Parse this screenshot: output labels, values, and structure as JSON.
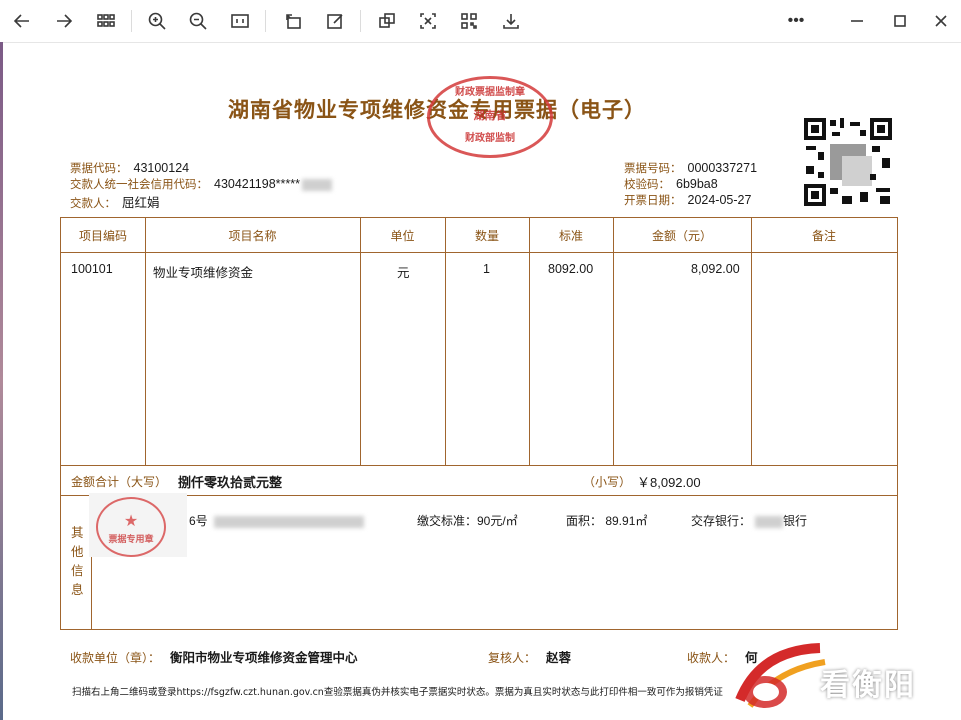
{
  "toolbar": {
    "back": "back",
    "forward": "forward",
    "thumbs": "thumbnails",
    "zoom_in": "zoom-in",
    "zoom_out": "zoom-out",
    "actual": "1:1",
    "rotate": "rotate",
    "edit": "edit",
    "translate": "translate",
    "text": "文",
    "qr": "qr",
    "save": "save",
    "more": "•••"
  },
  "doc": {
    "title": "湖南省物业专项维修资金专用票据（电子）",
    "seal_top_text": "财政票据监制章",
    "seal_top_mid": "湖南省",
    "seal_top_bot": "财政部监制",
    "code_label": "票据代码：",
    "code_value": "43100124",
    "credit_label": "交款人统一社会信用代码：",
    "credit_value": "430421198*****",
    "payer_label": "交款人：",
    "payer_value": "屈红娟",
    "number_label": "票据号码：",
    "number_value": "0000337271",
    "check_label": "校验码：",
    "check_value": "6b9ba8",
    "date_label": "开票日期：",
    "date_value": "2024-05-27"
  },
  "table": {
    "headers": [
      "项目编码",
      "项目名称",
      "单位",
      "数量",
      "标准",
      "金额（元）",
      "备注"
    ],
    "row": {
      "code": "100101",
      "name": "物业专项维修资金",
      "unit": "元",
      "qty": "1",
      "std": "8092.00",
      "amount": "8,092.00",
      "remark": ""
    },
    "total_label": "金额合计（大写）",
    "total_upper": "捌仟零玖拾贰元整",
    "total_small_label": "（小写）",
    "total_small": "￥8,092.00",
    "other_label": "其他信息",
    "other_address": "6号",
    "other_std": "缴交标准：90元/㎡",
    "other_area": "面积：  89.91㎡",
    "other_bank": "交存银行：",
    "other_bank_tail": "银行",
    "stamp_text": "票据专用章"
  },
  "footer": {
    "payee_label": "收款单位（章）：",
    "payee_value": "衡阳市物业专项维修资金管理中心",
    "reviewer_label": "复核人：",
    "reviewer_value": "赵蓉",
    "collector_label": "收款人：",
    "collector_value": "何",
    "note": "扫描右上角二维码或登录https://fsgzfw.czt.hunan.gov.cn查验票据真伪并核实电子票据实时状态。票据为真且实时状态与此打印件相一致可作为报销凭证",
    "brand": "看衡阳"
  },
  "colors": {
    "accent": "#8a5416",
    "border": "#a0652e",
    "seal": "#d43a3a"
  }
}
